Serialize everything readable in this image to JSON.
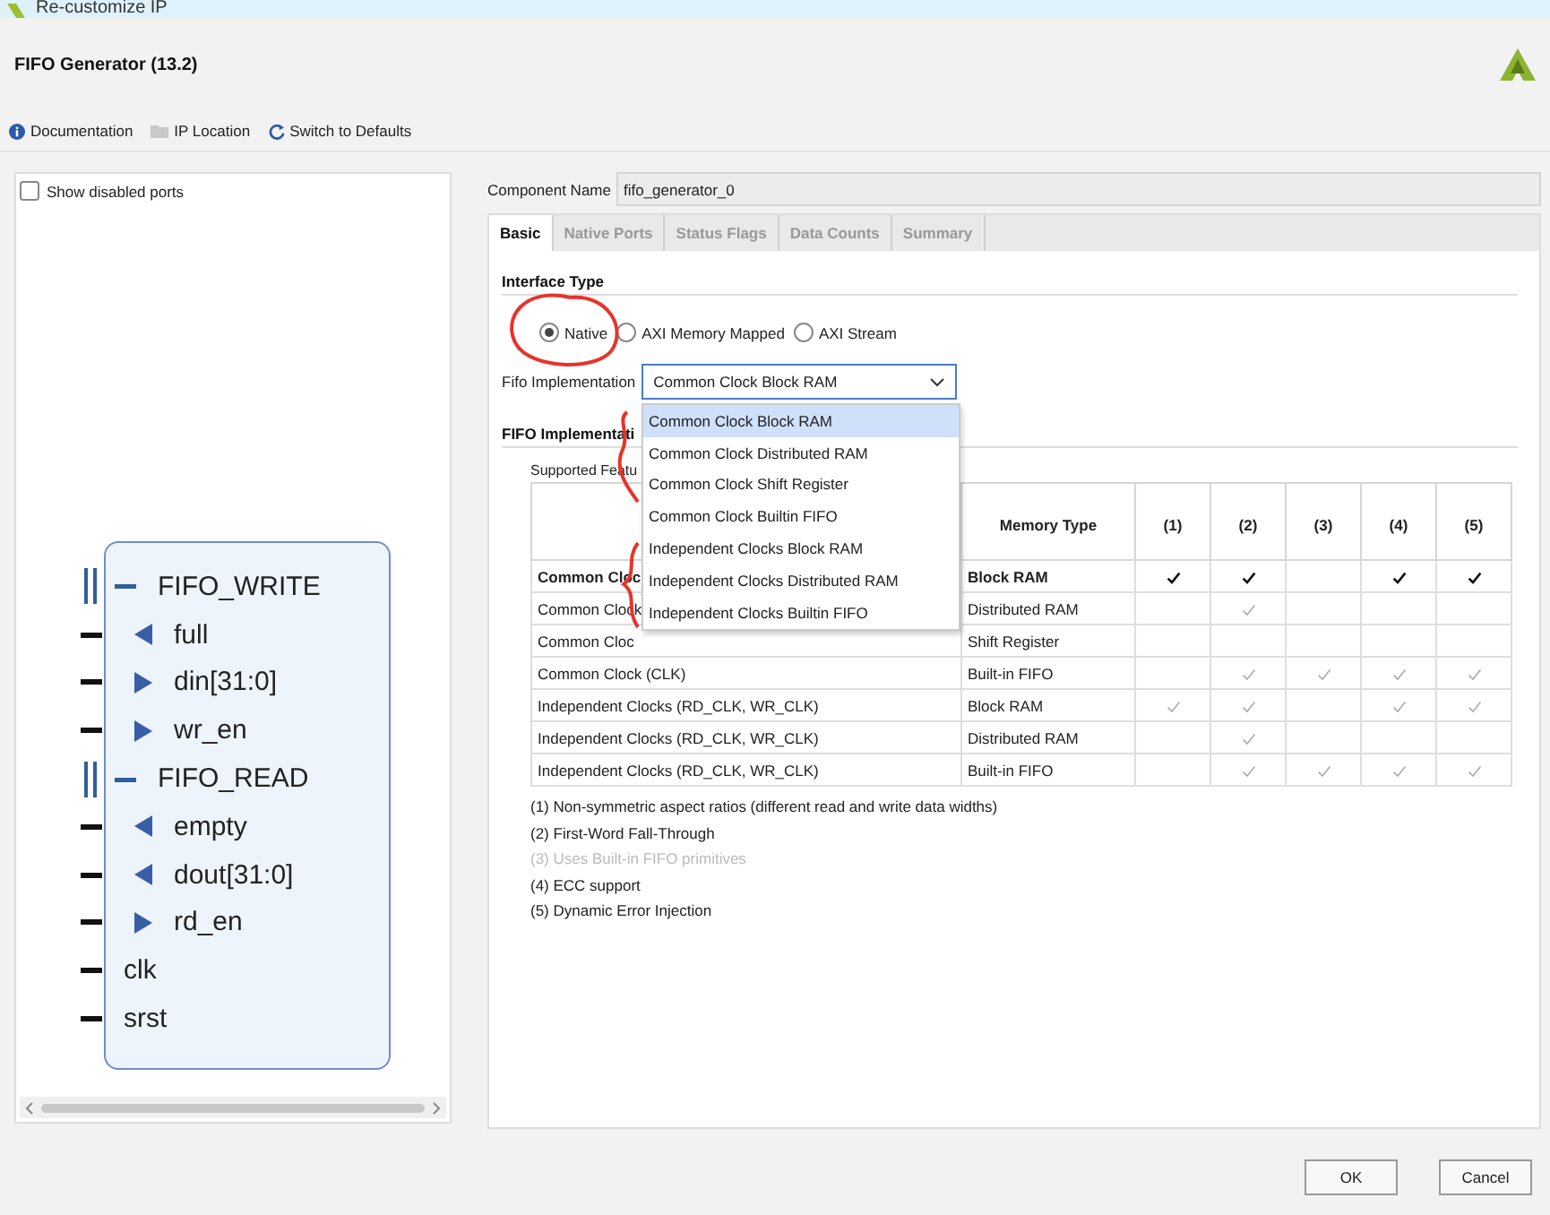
{
  "window": {
    "title": "Re-customize IP"
  },
  "header": {
    "title": "FIFO Generator (13.2)"
  },
  "toolbar": [
    {
      "kind": "info",
      "label": "Documentation",
      "disabled": false
    },
    {
      "kind": "folder",
      "label": "IP Location",
      "disabled": false
    },
    {
      "kind": "refresh",
      "label": "Switch to Defaults",
      "disabled": false
    }
  ],
  "symbol_panel": {
    "show_disabled_ports": {
      "label": "Show disabled ports",
      "checked": false
    },
    "ports": [
      {
        "kind": "bus",
        "label": "FIFO_WRITE",
        "expanded": true,
        "children": [
          {
            "kind": "out",
            "label": "full"
          },
          {
            "kind": "in",
            "label": "din[31:0]"
          },
          {
            "kind": "in",
            "label": "wr_en"
          }
        ]
      },
      {
        "kind": "bus",
        "label": "FIFO_READ",
        "expanded": true,
        "children": [
          {
            "kind": "out",
            "label": "empty"
          },
          {
            "kind": "out",
            "label": "dout[31:0]"
          },
          {
            "kind": "in",
            "label": "rd_en"
          }
        ]
      },
      {
        "kind": "plain",
        "label": "clk"
      },
      {
        "kind": "plain",
        "label": "srst"
      }
    ]
  },
  "component_name": {
    "label": "Component Name",
    "value": "fifo_generator_0"
  },
  "tabs": [
    {
      "label": "Basic",
      "selected": true
    },
    {
      "label": "Native Ports",
      "selected": false
    },
    {
      "label": "Status Flags",
      "selected": false
    },
    {
      "label": "Data Counts",
      "selected": false
    },
    {
      "label": "Summary",
      "selected": false
    }
  ],
  "interface_type": {
    "title": "Interface Type",
    "options": [
      {
        "label": "Native",
        "selected": true
      },
      {
        "label": "AXI Memory Mapped",
        "selected": false
      },
      {
        "label": "AXI Stream",
        "selected": false
      }
    ]
  },
  "fifo_implementation": {
    "label": "Fifo Implementation",
    "value": "Common Clock Block RAM",
    "options": [
      {
        "label": "Common Clock Block RAM",
        "selected": true
      },
      {
        "label": "Common Clock Distributed RAM",
        "selected": false
      },
      {
        "label": "Common Clock Shift Register",
        "selected": false
      },
      {
        "label": "Common Clock Builtin FIFO",
        "selected": false
      },
      {
        "label": "Independent Clocks Block RAM",
        "selected": false
      },
      {
        "label": "Independent Clocks Distributed RAM",
        "selected": false
      },
      {
        "label": "Independent Clocks Builtin FIFO",
        "selected": false
      }
    ]
  },
  "implementation_options": {
    "title": "FIFO Implementati",
    "supported_label": "Supported Featu",
    "table": {
      "columns": [
        "Memory Type",
        "(1)",
        "(2)",
        "(3)",
        "(4)",
        "(5)"
      ],
      "rows": [
        {
          "name": "Common Cloc",
          "memory": "Block RAM",
          "selected": true,
          "features": [
            {
              "checked": true
            },
            {
              "checked": true
            },
            {
              "checked": false
            },
            {
              "checked": true
            },
            {
              "checked": true
            }
          ]
        },
        {
          "name": "Common Clock",
          "memory": "Distributed RAM",
          "selected": false,
          "features": [
            {
              "checked": false
            },
            {
              "checked": true
            },
            {
              "checked": false
            },
            {
              "checked": false
            },
            {
              "checked": false
            }
          ]
        },
        {
          "name": "Common Cloc",
          "memory": "Shift Register",
          "selected": false,
          "features": [
            {
              "checked": false
            },
            {
              "checked": false
            },
            {
              "checked": false
            },
            {
              "checked": false
            },
            {
              "checked": false
            }
          ]
        },
        {
          "name": "Common Clock (CLK)",
          "memory": "Built-in FIFO",
          "selected": false,
          "features": [
            {
              "checked": false
            },
            {
              "checked": true
            },
            {
              "checked": true
            },
            {
              "checked": true
            },
            {
              "checked": true
            }
          ]
        },
        {
          "name": "Independent Clocks (RD_CLK, WR_CLK)",
          "memory": "Block RAM",
          "selected": false,
          "features": [
            {
              "checked": true
            },
            {
              "checked": true
            },
            {
              "checked": false
            },
            {
              "checked": true
            },
            {
              "checked": true
            }
          ]
        },
        {
          "name": "Independent Clocks (RD_CLK, WR_CLK)",
          "memory": "Distributed RAM",
          "selected": false,
          "features": [
            {
              "checked": false
            },
            {
              "checked": true
            },
            {
              "checked": false
            },
            {
              "checked": false
            },
            {
              "checked": false
            }
          ]
        },
        {
          "name": "Independent Clocks (RD_CLK, WR_CLK)",
          "memory": "Built-in FIFO",
          "selected": false,
          "features": [
            {
              "checked": false
            },
            {
              "checked": true
            },
            {
              "checked": true
            },
            {
              "checked": true
            },
            {
              "checked": true
            }
          ]
        }
      ]
    },
    "notes": [
      {
        "text": "(1) Non-symmetric aspect ratios (different read and write data widths)",
        "disabled": false
      },
      {
        "text": "(2) First-Word Fall-Through",
        "disabled": false
      },
      {
        "text": "(3) Uses Built-in FIFO primitives",
        "disabled": true
      },
      {
        "text": "(4) ECC support",
        "disabled": false
      },
      {
        "text": "(5) Dynamic Error Injection",
        "disabled": false
      }
    ]
  },
  "buttons": [
    {
      "label": "OK"
    },
    {
      "label": "Cancel"
    }
  ]
}
